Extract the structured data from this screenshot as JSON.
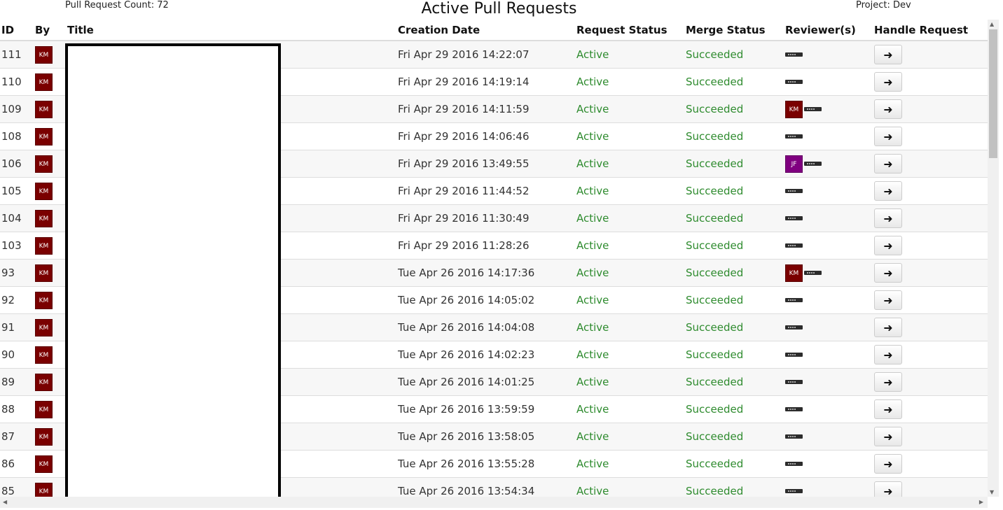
{
  "header": {
    "count_label": "Pull Request Count: 72",
    "title": "Active Pull Requests",
    "project_label": "Project: Dev"
  },
  "table": {
    "columns": [
      "ID",
      "By",
      "Title",
      "Creation Date",
      "Request Status",
      "Merge Status",
      "Reviewer(s)",
      "Handle Request"
    ],
    "rows": [
      {
        "id": "111",
        "by": "KM",
        "date": "Fri Apr 29 2016 14:22:07",
        "request_status": "Active",
        "merge_status": "Succeeded",
        "reviewers": []
      },
      {
        "id": "110",
        "by": "KM",
        "date": "Fri Apr 29 2016 14:19:14",
        "request_status": "Active",
        "merge_status": "Succeeded",
        "reviewers": []
      },
      {
        "id": "109",
        "by": "KM",
        "date": "Fri Apr 29 2016 14:11:59",
        "request_status": "Active",
        "merge_status": "Succeeded",
        "reviewers": [
          "KM"
        ]
      },
      {
        "id": "108",
        "by": "KM",
        "date": "Fri Apr 29 2016 14:06:46",
        "request_status": "Active",
        "merge_status": "Succeeded",
        "reviewers": []
      },
      {
        "id": "106",
        "by": "KM",
        "date": "Fri Apr 29 2016 13:49:55",
        "request_status": "Active",
        "merge_status": "Succeeded",
        "reviewers": [
          "JF"
        ]
      },
      {
        "id": "105",
        "by": "KM",
        "date": "Fri Apr 29 2016 11:44:52",
        "request_status": "Active",
        "merge_status": "Succeeded",
        "reviewers": []
      },
      {
        "id": "104",
        "by": "KM",
        "date": "Fri Apr 29 2016 11:30:49",
        "request_status": "Active",
        "merge_status": "Succeeded",
        "reviewers": []
      },
      {
        "id": "103",
        "by": "KM",
        "date": "Fri Apr 29 2016 11:28:26",
        "request_status": "Active",
        "merge_status": "Succeeded",
        "reviewers": []
      },
      {
        "id": "93",
        "by": "KM",
        "date": "Tue Apr 26 2016 14:17:36",
        "request_status": "Active",
        "merge_status": "Succeeded",
        "reviewers": [
          "KM"
        ]
      },
      {
        "id": "92",
        "by": "KM",
        "date": "Tue Apr 26 2016 14:05:02",
        "request_status": "Active",
        "merge_status": "Succeeded",
        "reviewers": []
      },
      {
        "id": "91",
        "by": "KM",
        "date": "Tue Apr 26 2016 14:04:08",
        "request_status": "Active",
        "merge_status": "Succeeded",
        "reviewers": []
      },
      {
        "id": "90",
        "by": "KM",
        "date": "Tue Apr 26 2016 14:02:23",
        "request_status": "Active",
        "merge_status": "Succeeded",
        "reviewers": []
      },
      {
        "id": "89",
        "by": "KM",
        "date": "Tue Apr 26 2016 14:01:25",
        "request_status": "Active",
        "merge_status": "Succeeded",
        "reviewers": []
      },
      {
        "id": "88",
        "by": "KM",
        "date": "Tue Apr 26 2016 13:59:59",
        "request_status": "Active",
        "merge_status": "Succeeded",
        "reviewers": []
      },
      {
        "id": "87",
        "by": "KM",
        "date": "Tue Apr 26 2016 13:58:05",
        "request_status": "Active",
        "merge_status": "Succeeded",
        "reviewers": []
      },
      {
        "id": "86",
        "by": "KM",
        "date": "Tue Apr 26 2016 13:55:28",
        "request_status": "Active",
        "merge_status": "Succeeded",
        "reviewers": []
      },
      {
        "id": "85",
        "by": "KM",
        "date": "Tue Apr 26 2016 13:54:34",
        "request_status": "Active",
        "merge_status": "Succeeded",
        "reviewers": []
      }
    ]
  },
  "icons": {
    "handle": "arrow-right-icon",
    "reviewer": "reviewer-group-icon"
  },
  "colors": {
    "avatar_km": "#7a0000",
    "avatar_jf": "#800080",
    "status_green": "#2e8b2e"
  }
}
